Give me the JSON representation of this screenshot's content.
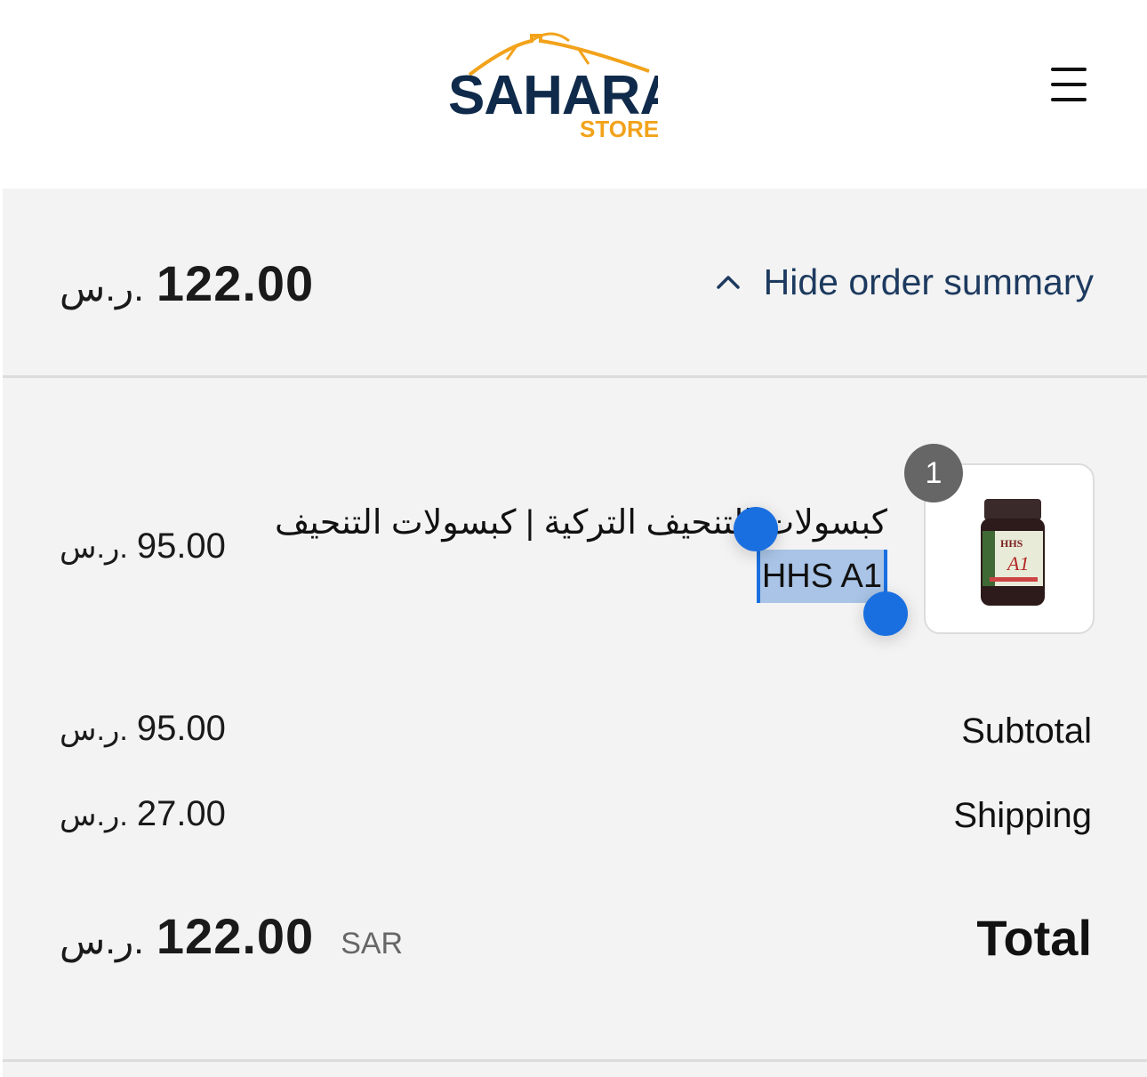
{
  "header": {
    "logo_text": "SAHARA",
    "logo_subtext": "STORE",
    "menu_icon": "hamburger-menu-icon",
    "brand_navy": "#0f2a4a",
    "brand_gold": "#f2a31b"
  },
  "summary": {
    "toggle_label": "Hide order summary",
    "toggle_icon": "chevron-up-icon",
    "total_amount": "122.00",
    "currency_symbol": "ر.س."
  },
  "item": {
    "quantity": "1",
    "title_line1": "كبسولات التنحيف التركية | كبسولات التنحيف",
    "title_line2": "HHS A1",
    "price": "95.00",
    "thumbnail": "supplement-bottle-image"
  },
  "totals": {
    "subtotal_label": "Subtotal",
    "subtotal_value": "95.00",
    "shipping_label": "Shipping",
    "shipping_value": "27.00",
    "total_label": "Total",
    "total_currency_code": "SAR",
    "total_value": "122.00"
  }
}
